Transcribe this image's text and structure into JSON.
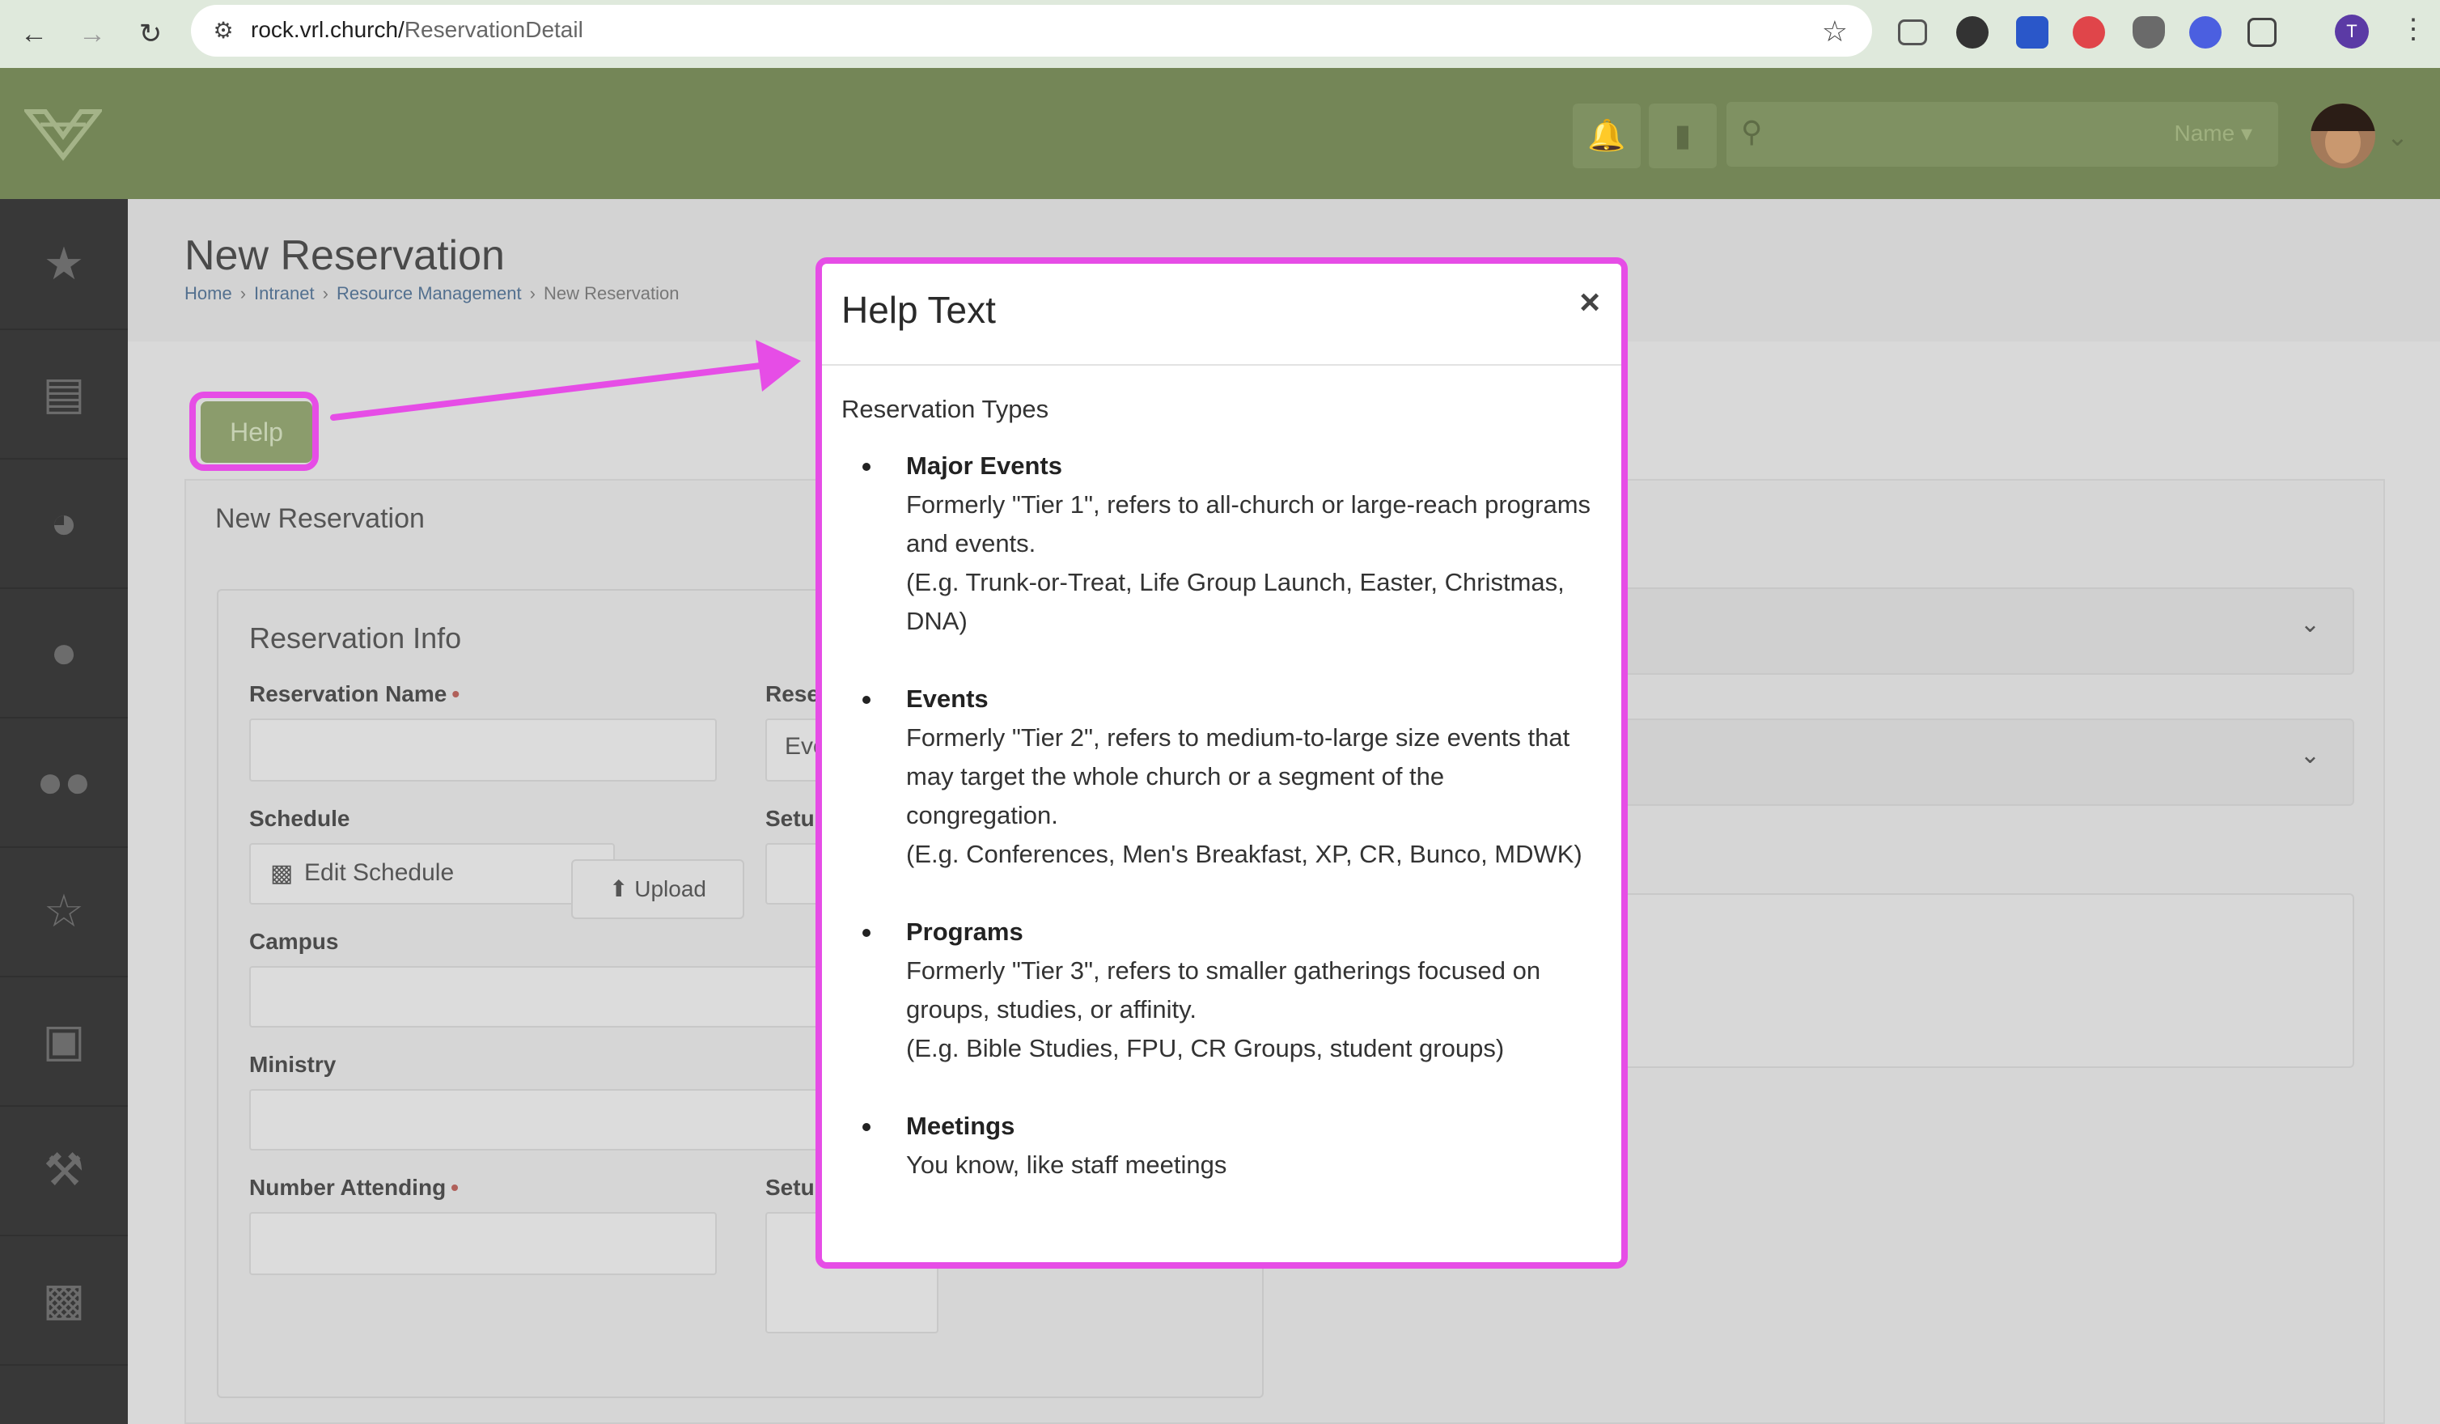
{
  "browser": {
    "url_host": "rock.vrl.church/",
    "url_path": "ReservationDetail",
    "profile_initial": "T"
  },
  "header": {
    "search_scope": "Name ▾"
  },
  "page": {
    "title": "New Reservation",
    "breadcrumbs": [
      "Home",
      "Intranet",
      "Resource Management",
      "New Reservation"
    ],
    "help_button": "Help"
  },
  "panel": {
    "title": "New Reservation",
    "section_title": "Reservation Info",
    "fields": {
      "reservation_name": "Reservation Name",
      "reservation_type": "Rese",
      "reservation_type_value": "Eve",
      "schedule": "Schedule",
      "edit_schedule": "Edit Schedule",
      "setup": "Setu",
      "campus": "Campus",
      "ministry": "Ministry",
      "number_attending": "Number Attending",
      "setup_photo": "Setu",
      "upload": "Upload",
      "required_mark": "•"
    }
  },
  "modal": {
    "title": "Help Text",
    "close": "×",
    "intro": "Reservation Types",
    "types": [
      {
        "name": "Major Events",
        "lines": [
          "Formerly \"Tier 1\", refers to all-church or large-reach programs and events.",
          "(E.g. Trunk-or-Treat, Life Group Launch, Easter, Christmas, DNA)"
        ]
      },
      {
        "name": "Events",
        "lines": [
          "Formerly \"Tier 2\", refers to medium-to-large size events that may target the whole church or a segment of the congregation.",
          "(E.g. Conferences, Men's Breakfast, XP, CR, Bunco, MDWK)"
        ]
      },
      {
        "name": "Programs",
        "lines": [
          "Formerly \"Tier 3\", refers to smaller gatherings focused on groups, studies, or affinity.",
          "(E.g. Bible Studies, FPU, CR Groups, student groups)"
        ]
      },
      {
        "name": "Meetings",
        "lines": [
          "You know, like staff meetings"
        ]
      }
    ]
  },
  "colors": {
    "header_green": "#748657",
    "annotation_magenta": "#e64de6",
    "sidebar": "#383838"
  }
}
